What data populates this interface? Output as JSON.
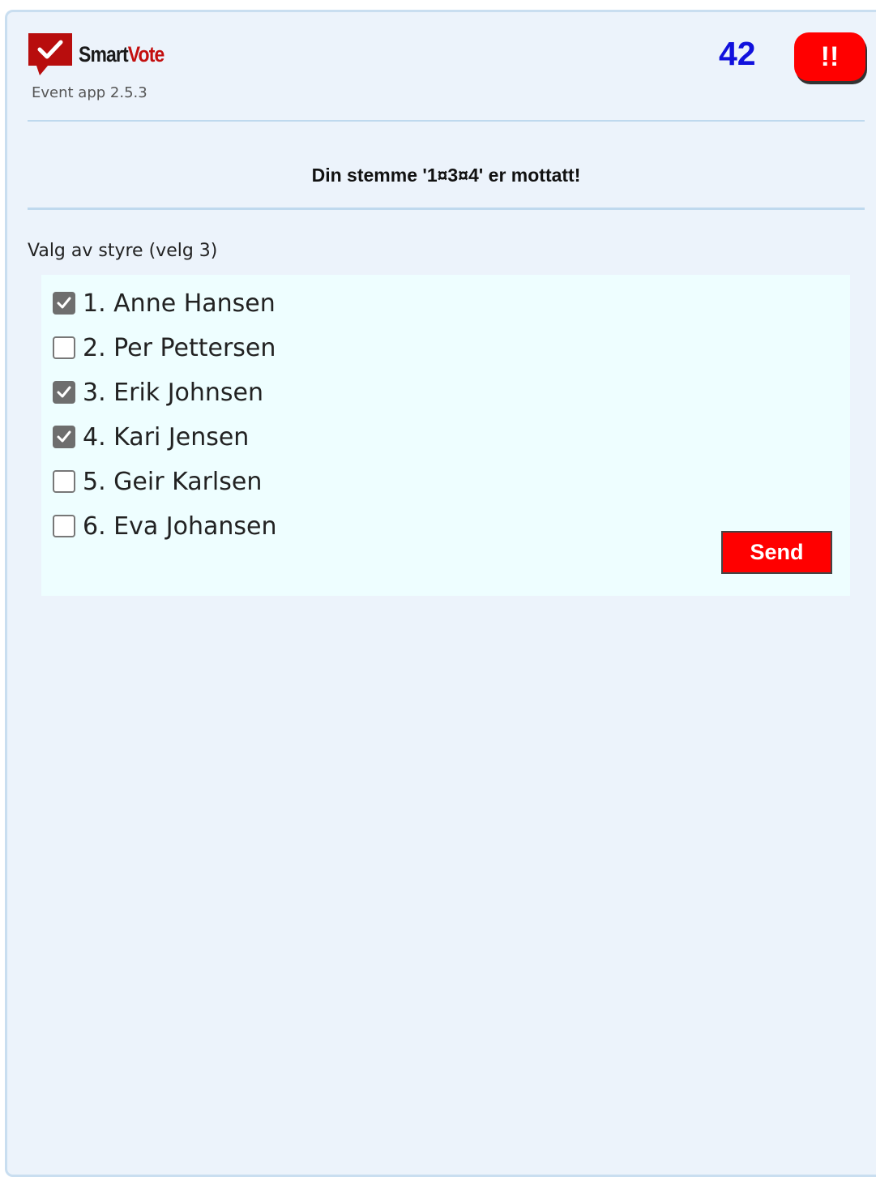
{
  "app": {
    "brand_part1": "Smart",
    "brand_part2": "Vote",
    "version": "Event app 2.5.3",
    "brand_color": "#c30f0f"
  },
  "header": {
    "counter": "42",
    "alert_label": "!!"
  },
  "status": {
    "message": "Din stemme '1¤3¤4' er mottatt!"
  },
  "vote": {
    "question": "Valg av styre (velg 3)",
    "options": [
      {
        "label": "1. Anne Hansen",
        "checked": true
      },
      {
        "label": "2. Per Pettersen",
        "checked": false
      },
      {
        "label": "3. Erik Johnsen",
        "checked": true
      },
      {
        "label": "4. Kari Jensen",
        "checked": true
      },
      {
        "label": "5. Geir Karlsen",
        "checked": false
      },
      {
        "label": "6. Eva Johansen",
        "checked": false
      }
    ],
    "send_label": "Send"
  },
  "icons": {
    "logo": "check-speech-bubble-icon",
    "checkmark": "checkmark-icon"
  }
}
